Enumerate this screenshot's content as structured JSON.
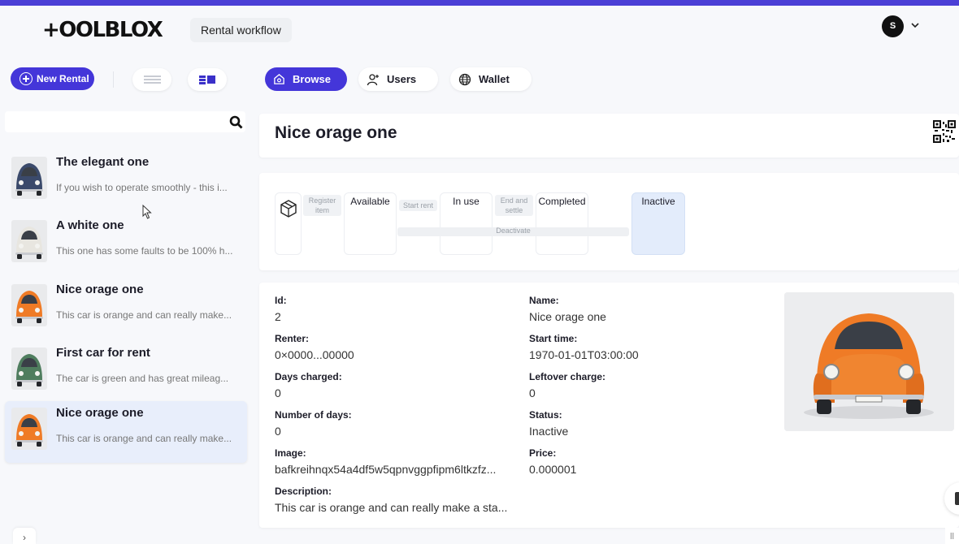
{
  "header": {
    "logo": "+OOLBLOX",
    "workflow_badge": "Rental workflow",
    "avatar_initial": "S"
  },
  "toolbar": {
    "new_rental_label": "New Rental",
    "nav": [
      {
        "label": "Browse",
        "active": true,
        "icon": "home-icon"
      },
      {
        "label": "Users",
        "active": false,
        "icon": "user-add-icon"
      },
      {
        "label": "Wallet",
        "active": false,
        "icon": "globe-icon"
      }
    ]
  },
  "search": {
    "value": "",
    "placeholder": ""
  },
  "list": {
    "items": [
      {
        "title": "The elegant one",
        "description": "If you wish to operate smoothly - this i...",
        "car_color": "#3b4a6b"
      },
      {
        "title": "A white one",
        "description": "This one has some faults to be 100% h...",
        "car_color": "#e8e6e0"
      },
      {
        "title": "Nice orage one",
        "description": "This car is orange and can really make...",
        "car_color": "#ef7b26"
      },
      {
        "title": "First car for rent",
        "description": "The car is green and has great mileag...",
        "car_color": "#4f7d5e"
      },
      {
        "title": "Nice orage one",
        "description": "This car is orange and can really make...",
        "car_color": "#ef7b26",
        "selected": true
      }
    ]
  },
  "detail": {
    "title": "Nice orage one",
    "workflow": {
      "states": [
        "Available",
        "In use",
        "Completed",
        "Inactive"
      ],
      "current_state": "Inactive",
      "transitions": [
        "Register item",
        "Start rent",
        "End and settle",
        "Deactivate"
      ]
    },
    "fields_left": [
      {
        "label": "Id:",
        "value": "2"
      },
      {
        "label": "Renter:",
        "value": "0×0000...00000"
      },
      {
        "label": "Days charged:",
        "value": "0"
      },
      {
        "label": "Number of days:",
        "value": "0"
      },
      {
        "label": "Image:",
        "value": "bafkreihnqx54a4df5w5qpnvggpfipm6ltkzfz..."
      },
      {
        "label": "Description:",
        "value": "This car is orange and can really make a sta..."
      }
    ],
    "fields_right": [
      {
        "label": "Name:",
        "value": "Nice orage one"
      },
      {
        "label": "Start time:",
        "value": "1970-01-01T03:00:00"
      },
      {
        "label": "Leftover charge:",
        "value": "0"
      },
      {
        "label": "Status:",
        "value": "Inactive"
      },
      {
        "label": "Price:",
        "value": "0.000001"
      }
    ]
  },
  "colors": {
    "accent": "#4436d9",
    "top_bar": "#4b3fd6",
    "selected_bg": "#e8eefb",
    "current_state_bg": "#e3ecfb"
  }
}
